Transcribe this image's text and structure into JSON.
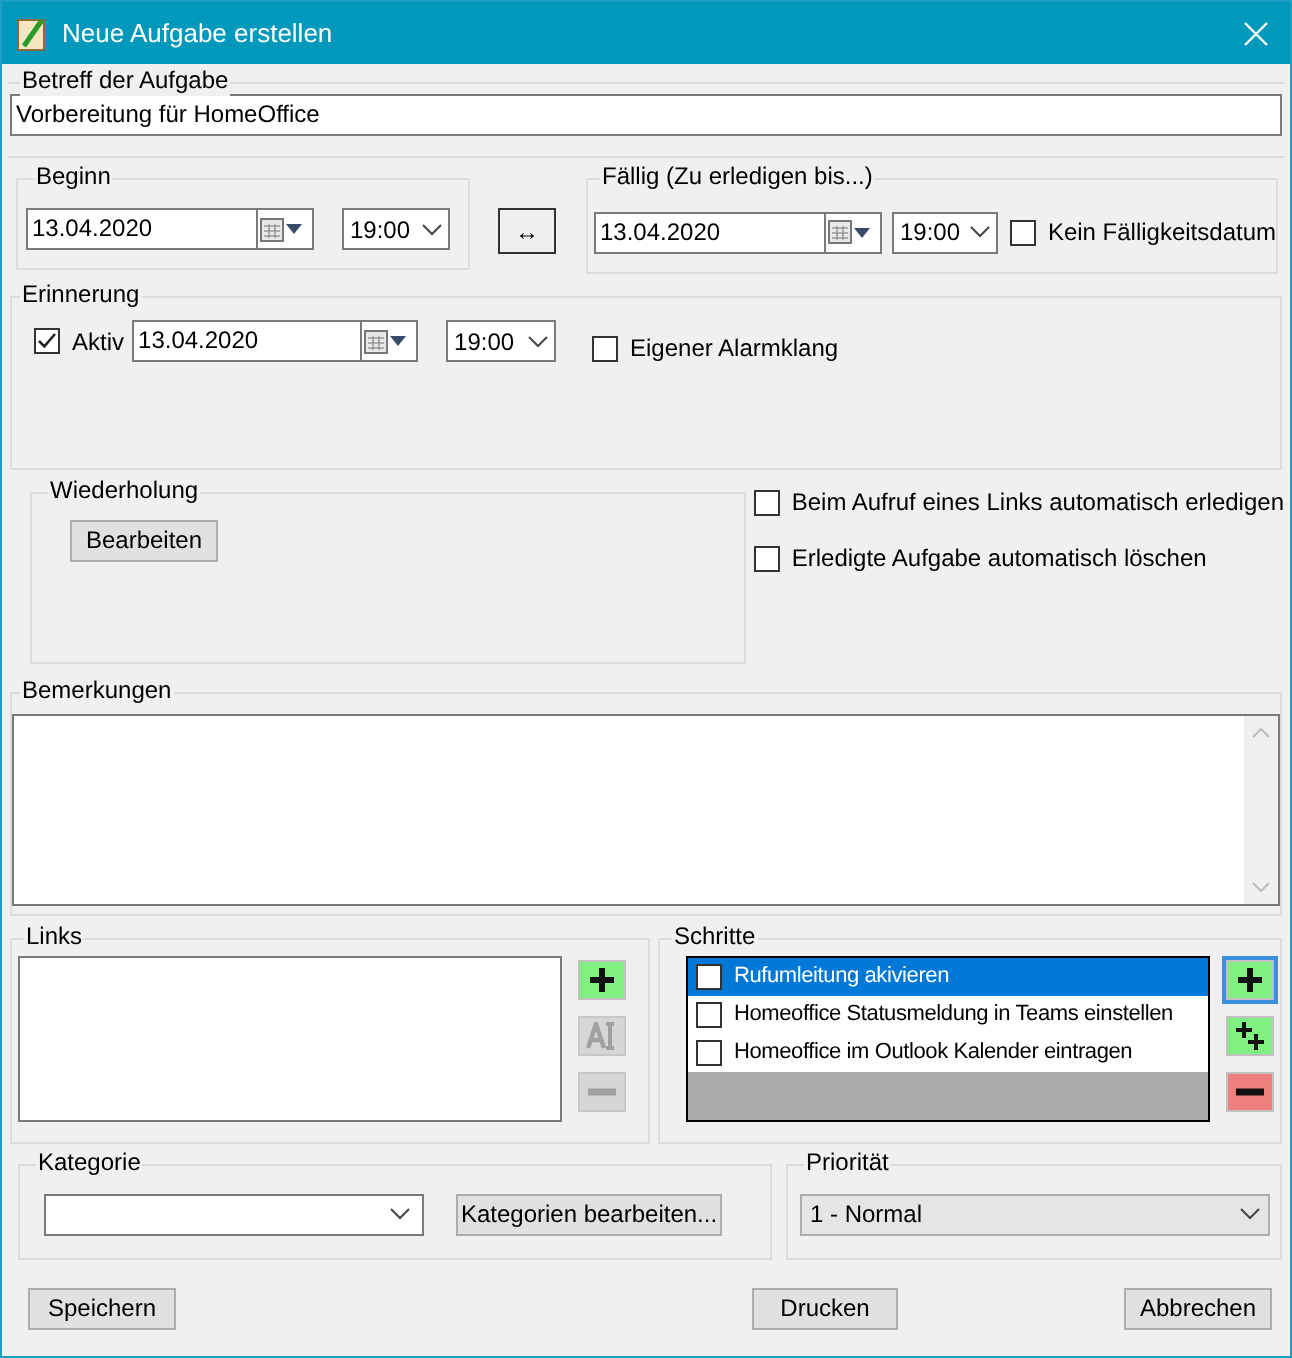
{
  "window": {
    "title": "Neue Aufgabe erstellen"
  },
  "subject": {
    "label": "Betreff der Aufgabe",
    "value": "Vorbereitung für HomeOffice"
  },
  "start": {
    "label": "Beginn",
    "date": "13.04.2020",
    "time": "19:00"
  },
  "swap_button": {
    "label": "↔"
  },
  "due": {
    "label": "Fällig (Zu erledigen bis...)",
    "date": "13.04.2020",
    "time": "19:00",
    "no_due_date": {
      "label": "Kein Fälligkeitsdatum",
      "checked": false
    }
  },
  "reminder": {
    "label": "Erinnerung",
    "active": {
      "label": "Aktiv",
      "checked": true
    },
    "date": "13.04.2020",
    "time": "19:00",
    "custom_sound": {
      "label": "Eigener Alarmklang",
      "checked": false
    }
  },
  "recurrence": {
    "label": "Wiederholung",
    "button": "Bearbeiten"
  },
  "options": [
    {
      "label": "Beim Aufruf eines Links automatisch erledigen",
      "checked": false
    },
    {
      "label": "Erledigte Aufgabe automatisch löschen",
      "checked": false
    }
  ],
  "notes": {
    "label": "Bemerkungen"
  },
  "links": {
    "label": "Links",
    "tools": [
      {
        "kind": "add",
        "disabled": false,
        "focused": false
      },
      {
        "kind": "rename",
        "disabled": true,
        "focused": false
      },
      {
        "kind": "remove",
        "disabled": true,
        "focused": false
      }
    ]
  },
  "steps": {
    "label": "Schritte",
    "items": [
      {
        "label": "Rufumleitung akivieren",
        "checked": false,
        "selected": true
      },
      {
        "label": "Homeoffice Statusmeldung in Teams einstellen",
        "checked": false,
        "selected": false
      },
      {
        "label": "Homeoffice im Outlook Kalender eintragen",
        "checked": false,
        "selected": false
      }
    ],
    "tools": [
      {
        "kind": "add",
        "disabled": false,
        "focused": true
      },
      {
        "kind": "add_sub",
        "disabled": false,
        "focused": false
      },
      {
        "kind": "remove",
        "disabled": false,
        "focused": false
      }
    ]
  },
  "category": {
    "label": "Kategorie",
    "button": "Kategorien bearbeiten..."
  },
  "priority": {
    "label": "Priorität",
    "value": "1 - Normal"
  },
  "buttons": [
    "Speichern",
    "Drucken",
    "Abbrechen"
  ]
}
